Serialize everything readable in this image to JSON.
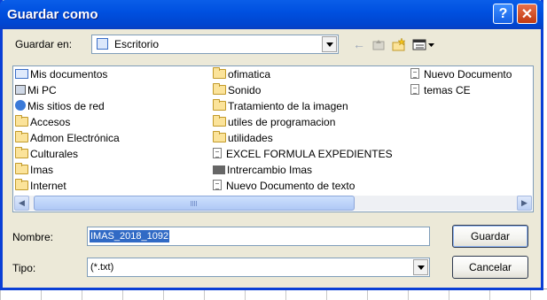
{
  "window": {
    "title": "Guardar como",
    "help_glyph": "?",
    "close_glyph": "✕"
  },
  "save_in": {
    "label": "Guardar en:",
    "value": "Escritorio"
  },
  "toolbar": {
    "back_glyph": "←"
  },
  "files": [
    {
      "name": "Mis documentos",
      "icon": "my-documents-icon",
      "col": 0,
      "row": 0
    },
    {
      "name": "Mi PC",
      "icon": "my-computer-icon",
      "col": 0,
      "row": 1
    },
    {
      "name": "Mis sitios de red",
      "icon": "network-places-icon",
      "col": 0,
      "row": 2
    },
    {
      "name": "Accesos",
      "icon": "folder-icon",
      "col": 0,
      "row": 3
    },
    {
      "name": "Admon Electrónica",
      "icon": "folder-icon",
      "col": 0,
      "row": 4
    },
    {
      "name": "Culturales",
      "icon": "folder-icon",
      "col": 0,
      "row": 5
    },
    {
      "name": "Imas",
      "icon": "folder-icon",
      "col": 0,
      "row": 6
    },
    {
      "name": "Internet",
      "icon": "folder-icon",
      "col": 0,
      "row": 7
    },
    {
      "name": "ofimatica",
      "icon": "folder-icon",
      "col": 1,
      "row": 0
    },
    {
      "name": "Sonido",
      "icon": "folder-icon",
      "col": 1,
      "row": 1
    },
    {
      "name": "Tratamiento de la imagen",
      "icon": "folder-icon",
      "col": 1,
      "row": 2
    },
    {
      "name": "utiles de programacion",
      "icon": "folder-icon",
      "col": 1,
      "row": 3
    },
    {
      "name": "utilidades",
      "icon": "folder-icon",
      "col": 1,
      "row": 4
    },
    {
      "name": "EXCEL FORMULA EXPEDIENTES",
      "icon": "text-document-icon",
      "col": 1,
      "row": 5
    },
    {
      "name": "Intrercambio Imas",
      "icon": "network-share-icon",
      "col": 1,
      "row": 6
    },
    {
      "name": "Nuevo Documento de texto",
      "icon": "text-document-icon",
      "col": 1,
      "row": 7
    },
    {
      "name": "Nuevo Documento",
      "icon": "text-document-icon",
      "col": 2,
      "row": 0
    },
    {
      "name": "temas CE",
      "icon": "text-document-icon",
      "col": 2,
      "row": 1
    }
  ],
  "scroll": {
    "left_glyph": "◀",
    "right_glyph": "▶"
  },
  "filename": {
    "label": "Nombre:",
    "value": "IMAS_2018_1092"
  },
  "filetype": {
    "label": "Tipo:",
    "value": "(*.txt)"
  },
  "buttons": {
    "save": "Guardar",
    "cancel": "Cancelar"
  },
  "colors": {
    "titlebar": "#0055e5",
    "dialog_bg": "#ece9d8",
    "selection": "#316ac5"
  }
}
